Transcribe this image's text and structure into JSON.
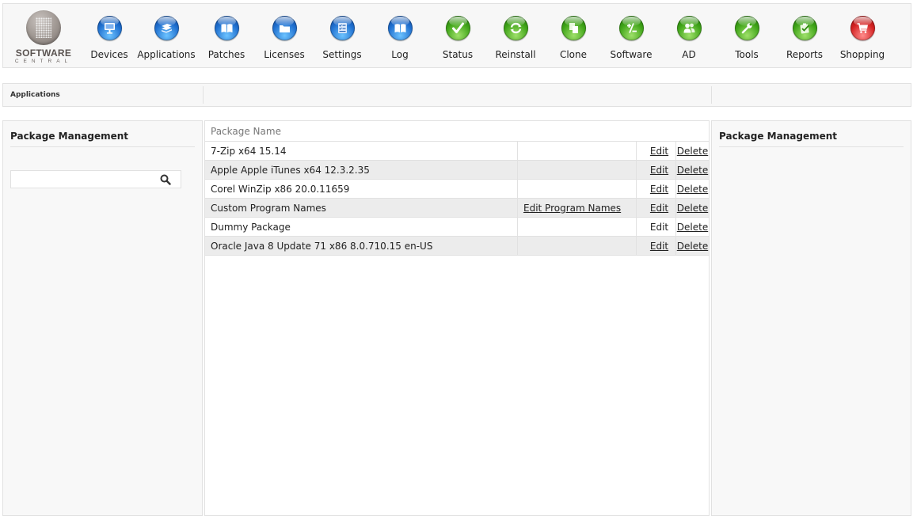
{
  "logo": {
    "line1": "SOFTWARE",
    "line2": "CENTRAL"
  },
  "nav": [
    {
      "label": "Devices",
      "icon": "monitor-icon",
      "color": "blue"
    },
    {
      "label": "Applications",
      "icon": "stack-icon",
      "color": "blue"
    },
    {
      "label": "Patches",
      "icon": "book-icon",
      "color": "blue"
    },
    {
      "label": "Licenses",
      "icon": "folder-icon",
      "color": "blue"
    },
    {
      "label": "Settings",
      "icon": "checklist-icon",
      "color": "blue"
    },
    {
      "label": "Log",
      "icon": "book-icon",
      "color": "blue"
    },
    {
      "label": "Status",
      "icon": "checkmark-icon",
      "color": "green"
    },
    {
      "label": "Reinstall",
      "icon": "refresh-icon",
      "color": "green"
    },
    {
      "label": "Clone",
      "icon": "copy-icon",
      "color": "green"
    },
    {
      "label": "Software",
      "icon": "plus-minus-icon",
      "color": "green"
    },
    {
      "label": "AD",
      "icon": "users-icon",
      "color": "green"
    },
    {
      "label": "Tools",
      "icon": "wrench-icon",
      "color": "green"
    },
    {
      "label": "Reports",
      "icon": "clipboard-check-icon",
      "color": "green"
    },
    {
      "label": "Shopping",
      "icon": "cart-icon",
      "color": "red"
    }
  ],
  "breadcrumb": {
    "current": "Applications"
  },
  "left_panel": {
    "title": "Package Management",
    "search": {
      "value": "",
      "placeholder": ""
    }
  },
  "right_panel": {
    "title": "Package Management"
  },
  "table": {
    "header": "Package Name",
    "rows": [
      {
        "name": "7-Zip x64 15.14",
        "extra": "",
        "edit": "Edit",
        "delete": "Delete",
        "edit_underlined": true
      },
      {
        "name": "Apple Apple iTunes x64 12.3.2.35",
        "extra": "",
        "edit": "Edit",
        "delete": "Delete",
        "edit_underlined": true
      },
      {
        "name": "Corel WinZip x86 20.0.11659",
        "extra": "",
        "edit": "Edit",
        "delete": "Delete",
        "edit_underlined": true
      },
      {
        "name": "Custom Program Names",
        "extra": "Edit Program Names",
        "edit": "Edit",
        "delete": "Delete",
        "edit_underlined": true
      },
      {
        "name": "Dummy Package",
        "extra": "",
        "edit": "Edit",
        "delete": "Delete",
        "edit_underlined": false
      },
      {
        "name": "Oracle Java 8 Update 71 x86 8.0.710.15 en-US",
        "extra": "",
        "edit": "Edit",
        "delete": "Delete",
        "edit_underlined": true
      }
    ]
  }
}
